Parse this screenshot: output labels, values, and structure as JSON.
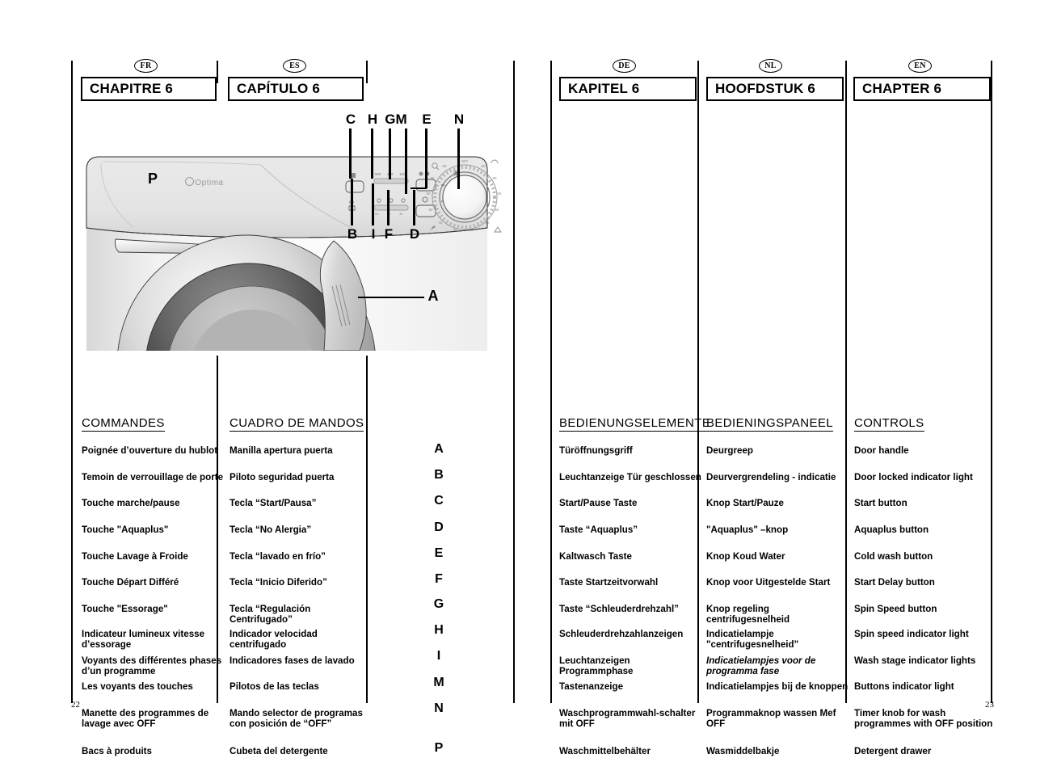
{
  "document": {
    "page_left": "22",
    "page_right": "23"
  },
  "languages": [
    {
      "code": "FR",
      "chapter": "CHAPITRE 6",
      "heading": "COMMANDES"
    },
    {
      "code": "ES",
      "chapter": "CAPÍTULO 6",
      "heading": "CUADRO DE MANDOS"
    },
    {
      "code": "DE",
      "chapter": "KAPITEL 6",
      "heading": "BEDIENUNGSELEMENTE"
    },
    {
      "code": "NL",
      "chapter": "HOOFDSTUK 6",
      "heading": "BEDIENINGSPANEEL"
    },
    {
      "code": "EN",
      "chapter": "CHAPTER 6",
      "heading": "CONTROLS"
    }
  ],
  "letters": [
    "A",
    "B",
    "C",
    "D",
    "E",
    "F",
    "G",
    "H",
    "I",
    "M",
    "N",
    "P"
  ],
  "controls": {
    "fr": [
      "Poignée d’ouverture du hublot",
      "Temoin de verrouillage de porte",
      "Touche marche/pause",
      "Touche \"Aquaplus\"",
      "Touche Lavage à Froide",
      "Touche Départ Différé",
      "Touche \"Essorage\"",
      "Indicateur lumineux vitesse d’essorage",
      "Voyants des  différentes phases d’un programme",
      "Les voyants des  touches",
      "Manette des programmes de lavage avec OFF",
      "Bacs à produits"
    ],
    "es": [
      "Manilla apertura puerta",
      "Piloto seguridad puerta",
      "Tecla “Start/Pausa”",
      "Tecla “No Alergia”",
      "Tecla “lavado en frío”",
      "Tecla “Inicio Diferido”",
      "Tecla “Regulación Centrifugado”",
      "Indicador velocidad centrifugado",
      "Indicadores fases de lavado",
      "Pilotos de las teclas",
      "Mando selector de programas con posición de “OFF”",
      "Cubeta del detergente"
    ],
    "de": [
      "Türöffnungsgriff",
      "Leuchtanzeige Tür geschlossen",
      "Start/Pause Taste",
      "Taste “Aquaplus”",
      "Kaltwasch Taste",
      "Taste Startzeitvorwahl",
      "Taste “Schleuderdrehzahl”",
      "Schleuderdrehzahlanzeigen",
      "Leuchtanzeigen Programmphase",
      "Tastenanzeige",
      "Waschprogrammwahl-schalter mit OFF",
      "Waschmittelbehälter"
    ],
    "nl": [
      "Deurgreep",
      "Deurvergrendeling - indicatie",
      "Knop Start/Pauze",
      "\"Aquaplus\" –knop",
      "Knop Koud Water",
      "Knop voor Uitgestelde Start",
      "Knop regeling centrifugesnelheid",
      "Indicatielampje \"centrifugesnelheid\"",
      "Indicatielampjes voor de programma fase",
      "Indicatielampjes bij de knoppen",
      "Programmaknop wassen Mef OFF",
      "Wasmiddelbakje"
    ],
    "en": [
      "Door handle",
      "Door locked indicator light",
      "Start button",
      "Aquaplus button",
      "Cold wash button",
      "Start Delay button",
      "Spin Speed button",
      "Spin speed indicator light",
      "Wash stage indicator lights",
      "Buttons indicator light",
      "Timer knob for wash programmes with OFF position",
      "Detergent drawer"
    ]
  },
  "diagram": {
    "brand": "Optima",
    "callouts_top": [
      "C",
      "H",
      "GM",
      "E",
      "N"
    ],
    "callouts_bottom": [
      "B",
      "I",
      "F",
      "D"
    ],
    "callout_drawer": "P",
    "callout_handle": "A"
  }
}
